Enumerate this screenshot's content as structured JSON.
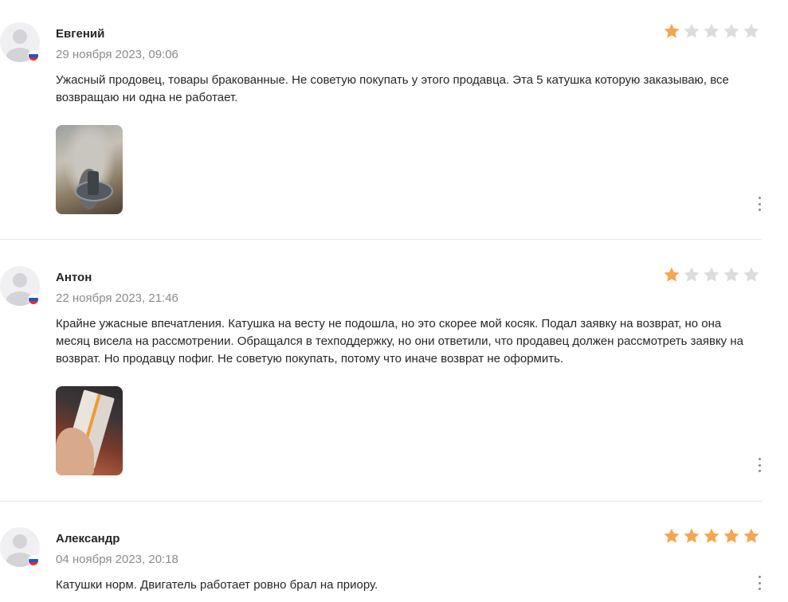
{
  "colors": {
    "star_filled": "#f7a64e",
    "star_empty": "#dcdcdc",
    "date": "#8b8b8b",
    "divider": "#e6e6e6"
  },
  "reviews": [
    {
      "author": "Евгений",
      "date": "29 ноября 2023, 09:06",
      "rating": 1,
      "text": "Ужасный продовец, товары бракованные. Не советую покупать у этого продавца. Эта 5 катушка которую заказываю, все возвращаю ни одна не работает.",
      "country_flag": "russia-flag-icon",
      "has_photo": true
    },
    {
      "author": "Антон",
      "date": "22 ноября 2023, 21:46",
      "rating": 1,
      "text": "Крайне ужасные впечатления. Катушка на весту не подошла, но это скорее мой косяк. Подал заявку на возврат, но она месяц висела на рассмотрении. Обращался в техподдержку, но они ответили, что продавец должен рассмотреть заявку на возврат. Но продавцу пофиг. Не советую покупать, потому что иначе возврат не оформить.",
      "country_flag": "russia-flag-icon",
      "has_photo": true
    },
    {
      "author": "Александр",
      "date": "04 ноября 2023, 20:18",
      "rating": 5,
      "text": "Катушки норм. Двигатель работает ровно брал на приору.",
      "country_flag": "russia-flag-icon",
      "has_photo": false
    }
  ]
}
